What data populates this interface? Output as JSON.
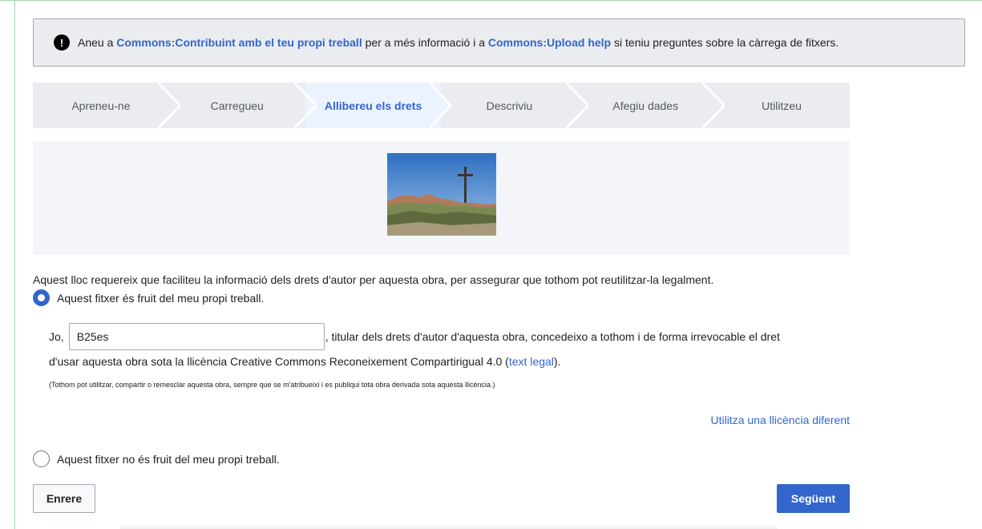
{
  "notice": {
    "icon": "exclamation-icon",
    "text_before": "Aneu a ",
    "link1": "Commons:Contribuint amb el teu propi treball",
    "text_middle": " per a més informació i a ",
    "link2": "Commons:Upload help",
    "text_after": " si teniu preguntes sobre la càrrega de fitxers."
  },
  "steps": [
    {
      "label": "Apreneu-ne"
    },
    {
      "label": "Carregueu"
    },
    {
      "label": "Allibereu els drets"
    },
    {
      "label": "Descriviu"
    },
    {
      "label": "Afegiu dades"
    },
    {
      "label": "Utilitzeu"
    }
  ],
  "active_step": "Allibereu els drets",
  "intro": "Aquest lloc requereix que faciliteu la informació dels drets d'autor per aquesta obra, per assegurar que tothom pot reutilitzar-la legalment.",
  "own_work": {
    "label": "Aquest fitxer és fruit del meu propi treball.",
    "checked": true
  },
  "license": {
    "prefix": "Jo,",
    "author_value": "B25es",
    "suffix": ", titular dels drets d'autor d'aquesta obra, concedeixo a tothom i de forma irrevocable el dret",
    "line2_before": "d'usar aquesta obra sota la llicència Creative Commons Reconeixement Compartirigual 4.0 (",
    "legal_link": "text legal",
    "line2_after": ").",
    "note": "(Tothom pot utilitzar, compartir o remesclar aquesta obra, sempre que se m'atribueixi i es publiqui tota obra derivada sota aquesta llicència.)",
    "alt_license_link": "Utilitza una llicència diferent"
  },
  "not_own_work": {
    "label": "Aquest fitxer no és fruit del meu propi treball.",
    "checked": false
  },
  "buttons": {
    "back": "Enrere",
    "next": "Següent"
  },
  "colors": {
    "accent": "#3366cc",
    "step_bg": "#eaecf0",
    "active_step_bg": "#eaf3ff"
  }
}
